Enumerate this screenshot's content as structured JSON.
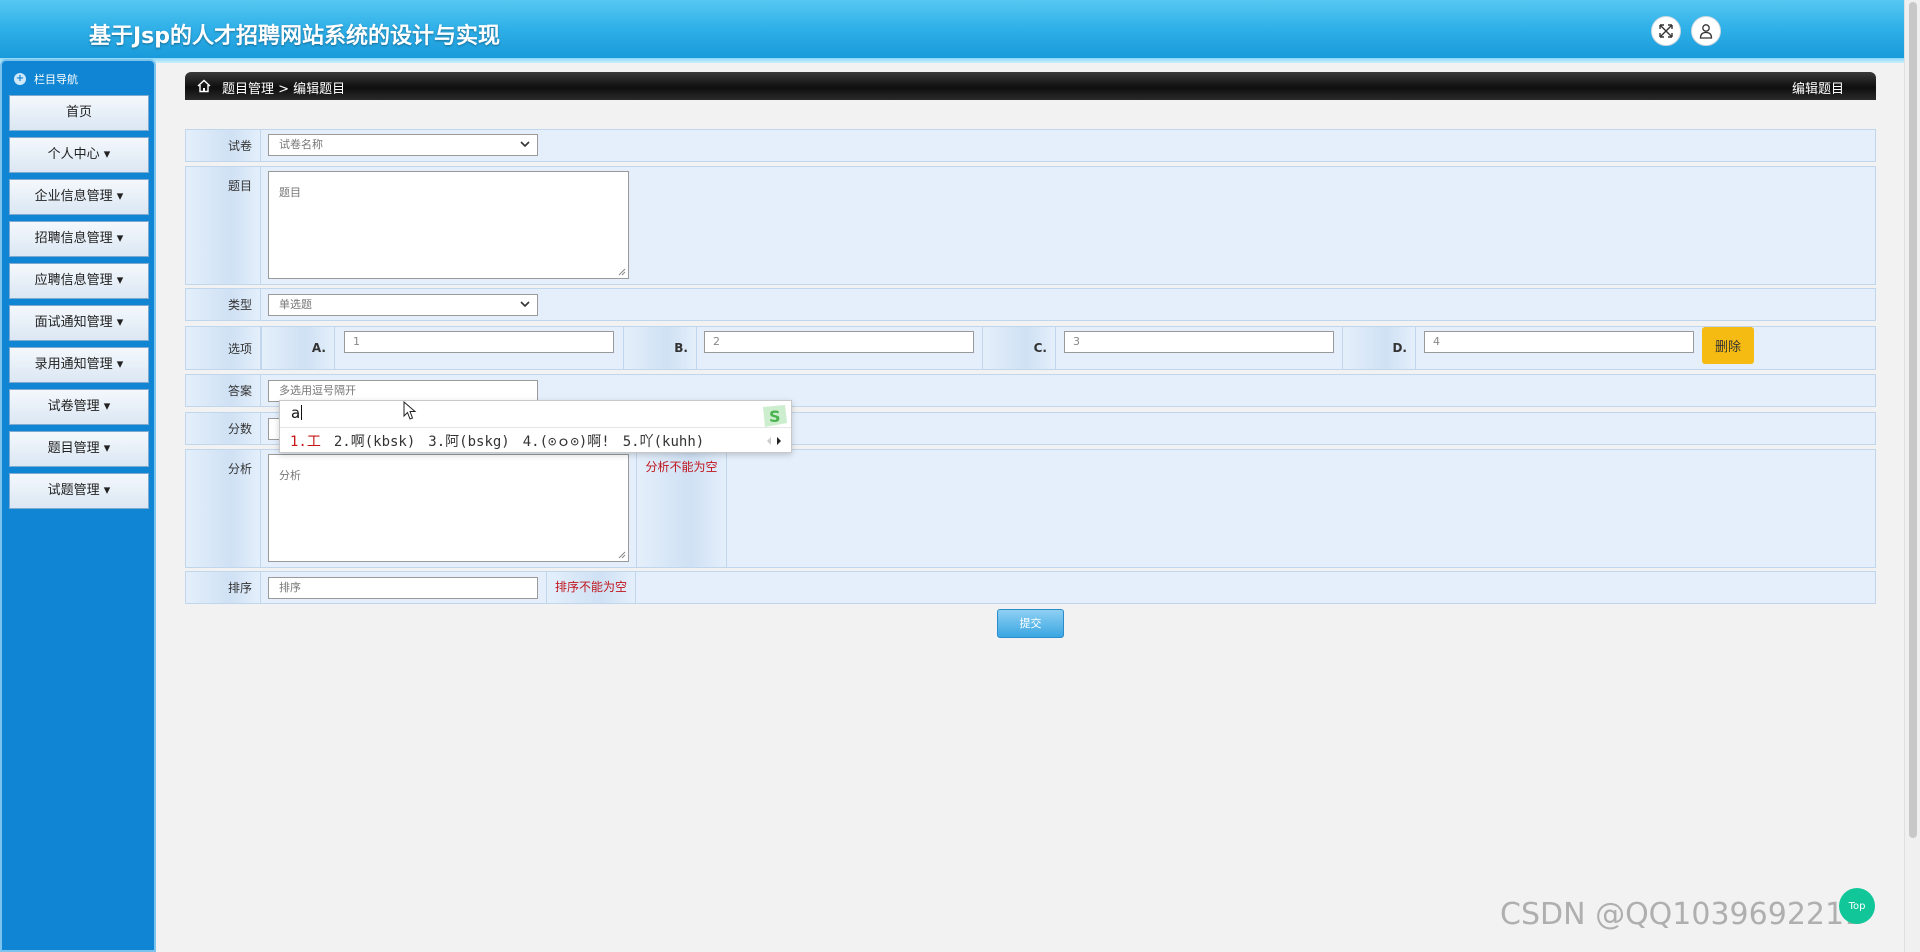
{
  "app": {
    "title": "基于Jsp的人才招聘网站系统的设计与实现"
  },
  "header": {
    "fullscreen_icon": "fullscreen-icon",
    "user_icon": "user-icon"
  },
  "sidebar": {
    "heading": "栏目导航",
    "items": [
      {
        "label": "首页"
      },
      {
        "label": "个人中心 ▾"
      },
      {
        "label": "企业信息管理 ▾"
      },
      {
        "label": "招聘信息管理 ▾"
      },
      {
        "label": "应聘信息管理 ▾"
      },
      {
        "label": "面试通知管理 ▾"
      },
      {
        "label": "录用通知管理 ▾"
      },
      {
        "label": "试卷管理 ▾"
      },
      {
        "label": "题目管理 ▾"
      },
      {
        "label": "试题管理 ▾"
      }
    ]
  },
  "breadcrumb": {
    "path": "题目管理 > 编辑题目",
    "page_title": "编辑题目"
  },
  "form": {
    "paper": {
      "label": "试卷",
      "selected": "试卷名称"
    },
    "question": {
      "label": "题目",
      "placeholder": "题目"
    },
    "type": {
      "label": "类型",
      "selected": "单选题"
    },
    "options": {
      "label": "选项",
      "items": [
        {
          "key": "A.",
          "value": "1"
        },
        {
          "key": "B.",
          "value": "2"
        },
        {
          "key": "C.",
          "value": "3"
        },
        {
          "key": "D.",
          "value": "4"
        }
      ],
      "delete_label": "删除"
    },
    "answer": {
      "label": "答案",
      "placeholder": "多选用逗号隔开"
    },
    "score": {
      "label": "分数"
    },
    "analysis": {
      "label": "分析",
      "placeholder": "分析",
      "error": "分析不能为空"
    },
    "sort": {
      "label": "排序",
      "placeholder": "排序",
      "error": "排序不能为空"
    },
    "submit_label": "提交"
  },
  "ime": {
    "composition": "a",
    "candidates": [
      "1.工",
      "2.啊(kbsk)",
      "3.阿(bskg)",
      "4.(⊙ｏ⊙)啊!",
      "5.吖(kuhh)"
    ]
  },
  "watermark": "CSDN @QQ1039692211",
  "top_button": "Top",
  "colors": {
    "header": "#2fb0e8",
    "sidebar": "#0f85d3",
    "error": "#c0141c",
    "delete": "#f5bb12"
  }
}
